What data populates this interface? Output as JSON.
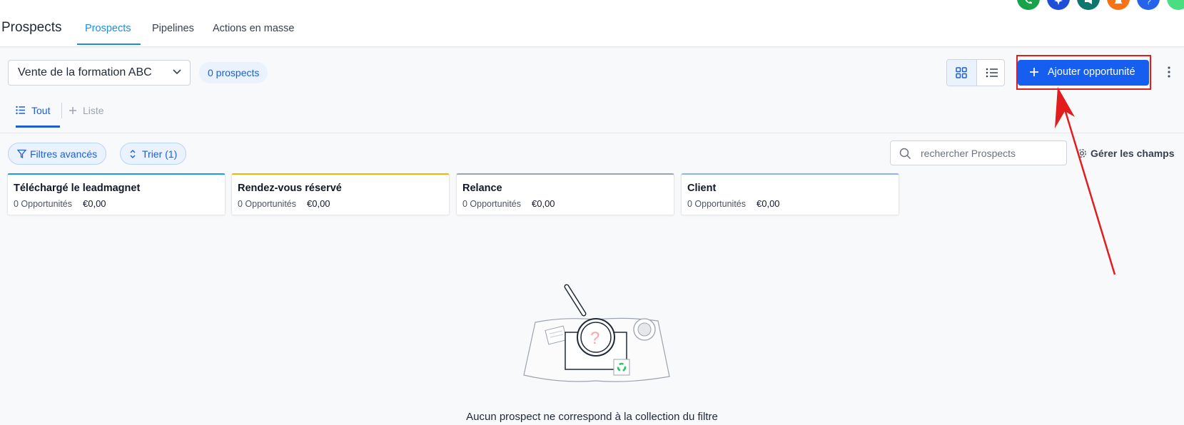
{
  "header": {
    "title": "Prospects",
    "tabs": [
      {
        "label": "Prospects",
        "active": true
      },
      {
        "label": "Pipelines",
        "active": false
      },
      {
        "label": "Actions en masse",
        "active": false
      }
    ],
    "top_icons": [
      {
        "name": "phone-icon",
        "color": "#16a34a"
      },
      {
        "name": "sparkle-icon",
        "color": "#1d4ed8"
      },
      {
        "name": "megaphone-icon",
        "color": "#0f766e"
      },
      {
        "name": "bell-icon",
        "color": "#f97316"
      },
      {
        "name": "help-icon",
        "color": "#2563eb"
      },
      {
        "name": "user-avatar",
        "color": "#4ade80"
      }
    ]
  },
  "toolbar": {
    "pipeline_select": "Vente de la formation ABC",
    "prospect_count": "0 prospects",
    "add_button": "Ajouter opportunité",
    "accent": "#155eef"
  },
  "subtabs": {
    "tout": "Tout",
    "liste": "Liste"
  },
  "filters": {
    "advanced": "Filtres avancés",
    "sort": "Trier (1)",
    "search_placeholder": "rechercher Prospects",
    "manage_fields": "Gérer les champs"
  },
  "stages": [
    {
      "name": "Téléchargé le leadmagnet",
      "count": "0 Opportunités",
      "amount": "€0,00",
      "color": "#1e9be0"
    },
    {
      "name": "Rendez-vous réservé",
      "count": "0 Opportunités",
      "amount": "€0,00",
      "color": "#f5b400"
    },
    {
      "name": "Relance",
      "count": "0 Opportunités",
      "amount": "€0,00",
      "color": "#9aa3b5"
    },
    {
      "name": "Client",
      "count": "0 Opportunités",
      "amount": "€0,00",
      "color": "#8fb4ea"
    }
  ],
  "empty_state": {
    "message": "Aucun prospect ne correspond à la collection du filtre"
  }
}
